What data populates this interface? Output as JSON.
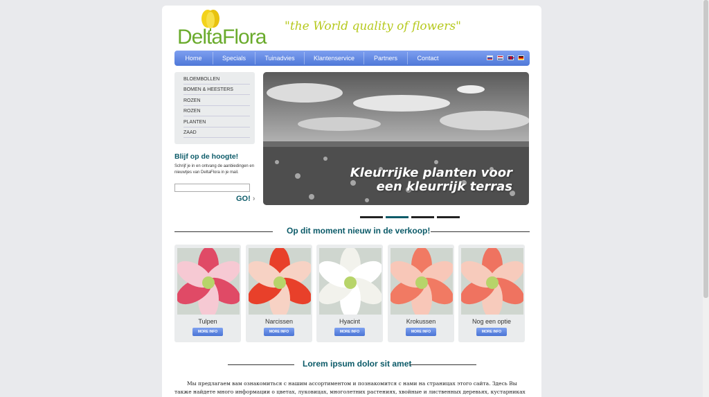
{
  "brand": {
    "name": "DeltaFlora",
    "tagline": "\"the World quality of flowers\""
  },
  "nav": {
    "items": [
      "Home",
      "Specials",
      "Tuinadvies",
      "Klantenservice",
      "Partners",
      "Contact"
    ],
    "languages": [
      "russian-flag-icon",
      "dutch-flag-icon",
      "english-flag-icon",
      "german-flag-icon"
    ]
  },
  "sidebar": {
    "categories": [
      "BLOEMBOLLEN",
      "BOMEN & HEESTERS",
      "ROZEN",
      "ROZEN",
      "PLANTEN",
      "ZAAD"
    ],
    "newsletter": {
      "title": "Blijf op de hoogte!",
      "text": "Schrijf je in en ontvang de aanbiedingen en nieuwtjes van DeltaFlora in je mail.",
      "input_value": "",
      "go_label": "GO!"
    }
  },
  "slider": {
    "caption_line1": "Kleurrijke planten voor",
    "caption_line2": "een kleurrijk terras",
    "slide_count": 4,
    "active_slide": 2
  },
  "new_section": {
    "title": "Op dit moment nieuw in de verkoop!"
  },
  "products": [
    {
      "name": "Tulpen",
      "button": "MORE INFO",
      "petal_color": "#e04a66",
      "edge_color": "#f6c9d3"
    },
    {
      "name": "Narcissen",
      "button": "MORE INFO",
      "petal_color": "#e8402a",
      "edge_color": "#f7d2c4"
    },
    {
      "name": "Hyacint",
      "button": "MORE INFO",
      "petal_color": "#f2f2ec",
      "edge_color": "#ffffff"
    },
    {
      "name": "Krokussen",
      "button": "MORE INFO",
      "petal_color": "#f17a63",
      "edge_color": "#f8c7b8"
    },
    {
      "name": "Nog een optie",
      "button": "MORE INFO",
      "petal_color": "#ef7360",
      "edge_color": "#f7cbbc"
    }
  ],
  "lorem_section": {
    "title": "Lorem ipsum dolor sit amet",
    "text": "Мы предлагаем вам ознакомиться с нашим ассортиментом и познакомится с нами на страницах этого сайта. Здесь Вы также найдете много информации о цветах, луковицах, многолетних растениях, хвойные и лиственных деревьях, кустарниках и, конечно, о посадочном материале. Вы будете"
  },
  "colors": {
    "accent": "#0b5a68",
    "nav": "#5b82de",
    "brand_green": "#6aab2c",
    "tagline": "#b6c91e"
  }
}
